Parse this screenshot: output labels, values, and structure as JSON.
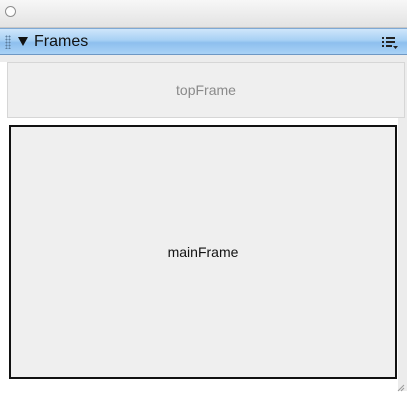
{
  "panel": {
    "title": "Frames",
    "frames": {
      "top": "topFrame",
      "main": "mainFrame"
    }
  },
  "icons": {
    "close": "close-circle-icon",
    "gripper": "gripper-icon",
    "disclosure": "disclosure-triangle-icon",
    "options": "options-menu-icon",
    "resize": "resize-grip-icon"
  },
  "colors": {
    "header_blue": "#a7d0f4",
    "frame_bg": "#efefef",
    "selected_border": "#111111"
  }
}
